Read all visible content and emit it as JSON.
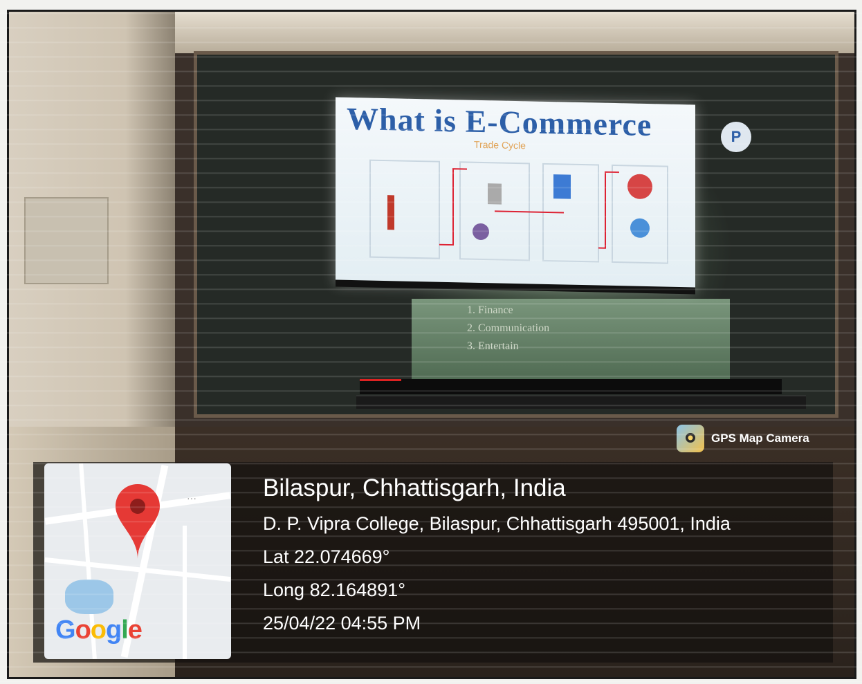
{
  "photo": {
    "slide_title": "What is E-Commerce",
    "slide_subtitle": "Trade Cycle",
    "lower_slide_lines": [
      "1. Finance",
      "2. Communication",
      "3. Entertain"
    ]
  },
  "gps_badge": {
    "label": "GPS Map Camera",
    "icon": "gps-map-camera-icon"
  },
  "map": {
    "logo_text": "Google",
    "pin_icon": "map-pin-icon",
    "menu_icon": "more-dots-icon"
  },
  "location": {
    "city": "Bilaspur, Chhattisgarh, India",
    "address": "D. P. Vipra College, Bilaspur, Chhattisgarh 495001, India",
    "lat": "Lat 22.074669°",
    "long": "Long 82.164891°",
    "timestamp": "25/04/22 04:55 PM"
  },
  "colors": {
    "pin": "#e53935",
    "slide_title": "#2d5fa8"
  }
}
